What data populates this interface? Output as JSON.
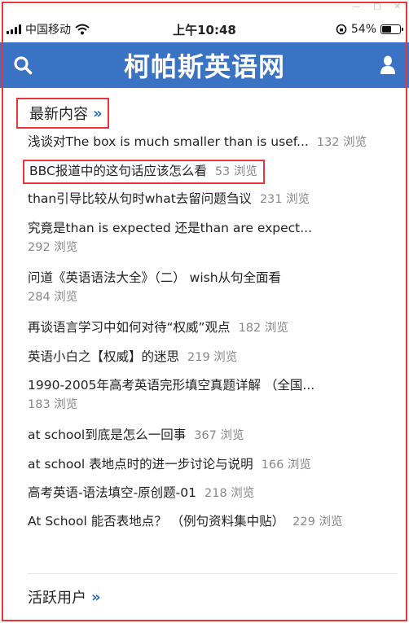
{
  "status_bar": {
    "carrier": "中国移动",
    "time": "上午10:48",
    "battery": "54%",
    "battery_level": 0.54
  },
  "header": {
    "title": "柯帕斯英语网"
  },
  "latest": {
    "heading": "最新内容",
    "chevron": "»",
    "items": [
      {
        "title": "浅谈对The box is much smaller than is usef...",
        "views": "132 浏览"
      },
      {
        "title": "BBC报道中的这句话应该怎么看",
        "views": "53 浏览"
      },
      {
        "title": "than引导比较从句时what去留问题刍议",
        "views": "231 浏览"
      },
      {
        "title": "究竟是than is expected 还是than are expect...",
        "views": "292 浏览"
      },
      {
        "title": "问道《英语语法大全》（二） wish从句全面看",
        "views": "284 浏览"
      },
      {
        "title": "再谈语言学习中如何对待“权威”观点",
        "views": "182 浏览"
      },
      {
        "title": "英语小白之【权威】的迷思",
        "views": "219 浏览"
      },
      {
        "title": "1990-2005年高考英语完形填空真题详解 （全国...",
        "views": "183 浏览"
      },
      {
        "title": "at school到底是怎么一回事",
        "views": "367 浏览"
      },
      {
        "title": "at school 表地点时的进一步讨论与说明",
        "views": "166 浏览"
      },
      {
        "title": "高考英语-语法填空-原创题-01",
        "views": "218 浏览"
      },
      {
        "title": "At School 能否表地点？ （例句资料集中贴）",
        "views": "229 浏览"
      }
    ]
  },
  "active_users": {
    "heading": "活跃用户",
    "chevron": "»"
  }
}
